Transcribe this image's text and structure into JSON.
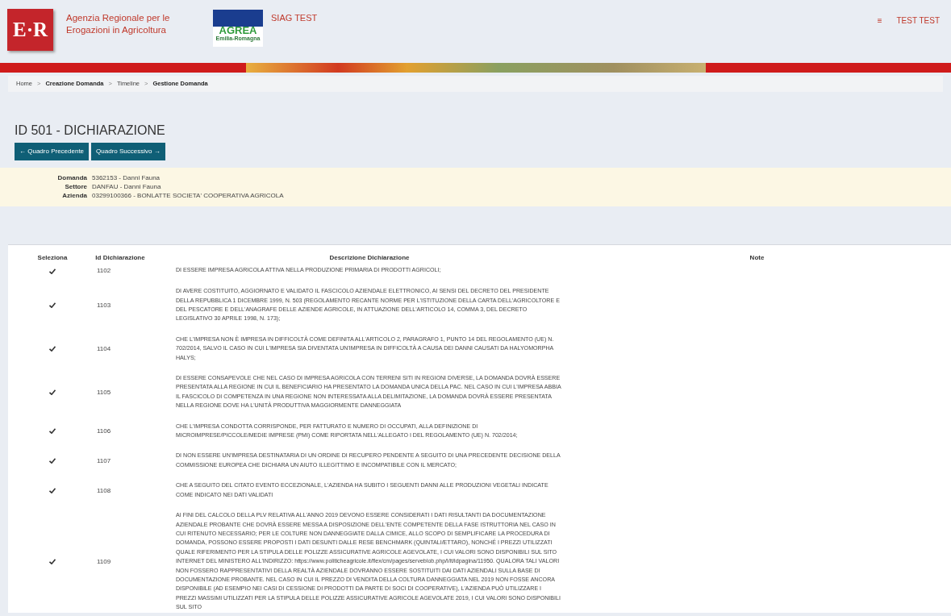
{
  "header": {
    "logo_text": "E·R",
    "agency": "Agenzia Regionale per le Erogazioni in Agricoltura",
    "agrea_logo": {
      "title": "AGREA",
      "subtitle": "Emilia-Romagna"
    },
    "app_name": "SIAG TEST",
    "menu_icon": "≡",
    "user": "TEST TEST"
  },
  "breadcrumb": [
    {
      "label": "Home",
      "link": true
    },
    {
      "label": "Creazione Domanda",
      "link": false
    },
    {
      "label": "Timeline",
      "link": true
    },
    {
      "label": "Gestione Domanda",
      "link": false
    }
  ],
  "separator": ">",
  "page_title": "ID 501 - DICHIARAZIONE",
  "nav_buttons": [
    {
      "label": "Quadro Precedente",
      "kind": "prev",
      "arrow": "←"
    },
    {
      "label": "Quadro Successivo",
      "kind": "next",
      "arrow": "→"
    }
  ],
  "info": [
    {
      "label": "Domanda",
      "value": "5362153 - Danni Fauna"
    },
    {
      "label": "Settore",
      "value": "DANFAU - Danni Fauna"
    },
    {
      "label": "Azienda",
      "value": "03299100366 - BONLATTE SOCIETA' COOPERATIVA AGRICOLA"
    }
  ],
  "table": {
    "columns": [
      "Seleziona",
      "Id Dichiarazione",
      "Descrizione Dichiarazione",
      "Note"
    ],
    "rows": [
      {
        "selected": true,
        "id": "1102",
        "description": "DI ESSERE IMPRESA AGRICOLA ATTIVA NELLA PRODUZIONE PRIMARIA DI PRODOTTI AGRICOLI;"
      },
      {
        "selected": true,
        "id": "1103",
        "description": "DI AVERE COSTITUITO, AGGIORNATO E VALIDATO IL FASCICOLO AZIENDALE ELETTRONICO, AI SENSI DEL DECRETO DEL PRESIDENTE DELLA REPUBBLICA 1 DICEMBRE 1999, N. 503 (REGOLAMENTO RECANTE NORME PER L'ISTITUZIONE DELLA CARTA DELL'AGRICOLTORE E DEL PESCATORE E DELL'ANAGRAFE DELLE AZIENDE AGRICOLE, IN ATTUAZIONE DELL'ARTICOLO 14, COMMA 3, DEL DECRETO LEGISLATIVO 30 APRILE 1998, N. 173);"
      },
      {
        "selected": true,
        "id": "1104",
        "description": "CHE L'IMPRESA NON È IMPRESA IN DIFFICOLTÀ COME DEFINITA ALL'ARTICOLO 2, PARAGRAFO 1, PUNTO 14 DEL REGOLAMENTO (UE) N. 702/2014, SALVO IL CASO IN CUI L'IMPRESA SIA DIVENTATA UN'IMPRESA IN DIFFICOLTÀ A CAUSA DEI DANNI CAUSATI DA HALYOMORPHA HALYS;"
      },
      {
        "selected": true,
        "id": "1105",
        "description": "DI ESSERE CONSAPEVOLE CHE NEL CASO DI IMPRESA AGRICOLA CON TERRENI SITI IN REGIONI DIVERSE, LA DOMANDA DOVRÀ ESSERE PRESENTATA ALLA REGIONE IN CUI IL BENEFICIARIO HA PRESENTATO LA DOMANDA UNICA DELLA PAC. NEL CASO IN CUI L'IMPRESA ABBIA IL FASCICOLO DI COMPETENZA IN UNA REGIONE NON INTERESSATA ALLA DELIMITAZIONE, LA DOMANDA DOVRÀ ESSERE PRESENTATA NELLA REGIONE DOVE HA L'UNITÀ PRODUTTIVA MAGGIORMENTE DANNEGGIATA"
      },
      {
        "selected": true,
        "id": "1106",
        "description": "CHE L'IMPRESA CONDOTTA CORRISPONDE, PER FATTURATO E NUMERO DI OCCUPATI, ALLA DEFINIZIONE DI MICROIMPRESE/PICCOLE/MEDIE IMPRESE (PMI) COME RIPORTATA NELL'ALLEGATO I DEL REGOLAMENTO (UE) N. 702/2014;"
      },
      {
        "selected": true,
        "id": "1107",
        "description": "DI NON ESSERE UN'IMPRESA DESTINATARIA DI UN ORDINE DI RECUPERO PENDENTE A SEGUITO DI UNA PRECEDENTE DECISIONE DELLA COMMISSIONE EUROPEA CHE DICHIARA UN AIUTO ILLEGITTIMO E INCOMPATIBILE CON IL MERCATO;"
      },
      {
        "selected": true,
        "id": "1108",
        "description": "CHE A SEGUITO DEL CITATO EVENTO ECCEZIONALE, L'AZIENDA HA SUBITO I SEGUENTI DANNI ALLE PRODUZIONI VEGETALI INDICATE COME INDICATO NEI DATI VALIDATI"
      },
      {
        "selected": true,
        "id": "1109",
        "description": "AI FINI DEL CALCOLO DELLA PLV RELATIVA ALL'ANNO 2019 DEVONO ESSERE CONSIDERATI I DATI RISULTANTI DA DOCUMENTAZIONE AZIENDALE PROBANTE CHE DOVRÀ ESSERE MESSA A DISPOSIZIONE DELL'ENTE COMPETENTE DELLA FASE ISTRUTTORIA NEL CASO IN CUI RITENUTO NECESSARIO; PER LE COLTURE NON DANNEGGIATE DALLA CIMICE, ALLO SCOPO DI SEMPLIFICARE LA PROCEDURA DI DOMANDA, POSSONO ESSERE PROPOSTI I DATI DESUNTI DALLE RESE BENCHMARK (QUINTALI/ETTARO), NONCHÉ I PREZZI UTILIZZATI QUALE RIFERIMENTO PER LA STIPULA DELLE POLIZZE ASSICURATIVE AGRICOLE AGEVOLATE, I CUI VALORI SONO DISPONIBILI SUL SITO INTERNET DEL MINISTERO ALL'INDIRIZZO: https://www.politicheagricole.it/flex/cm/pages/serveblob.php/l/it/idpagina/11950. QUALORA TALI VALORI NON FOSSERO RAPPRESENTATIVI DELLA REALTÀ AZIENDALE DOVRANNO ESSERE SOSTITUITI DAI DATI AZIENDALI SULLA BASE DI DOCUMENTAZIONE PROBANTE. NEL CASO IN CUI IL PREZZO DI VENDITA DELLA COLTURA DANNEGGIATA NEL 2019 NON FOSSE ANCORA DISPONIBILE (AD ESEMPIO NEI CASI DI CESSIONE DI PRODOTTI DA PARTE DI SOCI DI COOPERATIVE), L'AZIENDA PUÒ UTILIZZARE I PREZZI MASSIMI UTILIZZATI PER LA STIPULA DELLE POLIZZE ASSICURATIVE AGRICOLE AGEVOLATE 2019, I CUI VALORI SONO DISPONIBILI SUL SITO"
      }
    ]
  }
}
